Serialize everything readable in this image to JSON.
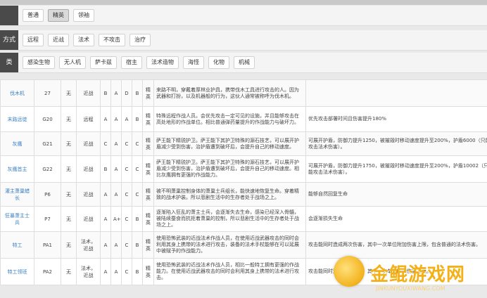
{
  "filters": [
    {
      "label": "",
      "chips": [
        "普通",
        "精英",
        "领袖"
      ],
      "active": 1
    },
    {
      "label": "方式",
      "chips": [
        "远程",
        "近战",
        "法术",
        "不攻击",
        "治疗"
      ],
      "active": -1
    },
    {
      "label": "类",
      "chips": [
        "感染生物",
        "无人机",
        "萨卡兹",
        "宿主",
        "法术造物",
        "海怪",
        "化物",
        "机械"
      ],
      "active": -1
    }
  ],
  "rows": [
    {
      "name": "伐木机",
      "code": "27",
      "def": "无",
      "atk": "近战",
      "s": [
        "B",
        "A",
        "D",
        "B"
      ],
      "lvl": "精英",
      "desc": "来路不明，穿戴着厚林业护具，携带伐木工具进行攻击的人。因为武器和打扮，以及机器般的行为，这伙人通常被称呼为伐木机。",
      "note": ""
    },
    {
      "name": "末路远徒",
      "code": "G20",
      "def": "无",
      "atk": "远程",
      "s": [
        "A",
        "A",
        "A",
        "B"
      ],
      "lvl": "精英",
      "desc": "特殊远程作战人员。会优先攻击一定可见的设施，并且能够攻击在高处地形的作战单位。相比普通弹药量提升的作战能力与破坏力。",
      "note": "优先攻击部署时间且伤害提升180%"
    },
    {
      "name": "灰鹰",
      "code": "G21",
      "def": "无",
      "atk": "近战",
      "s": [
        "C",
        "A",
        "C",
        "C"
      ],
      "lvl": "精英",
      "desc": "萨王能下精锐护卫。萨王能下其护卫特殊的源石技艺，可以展开护盾减少受到伤害，治护盾遭到破坏后，会提升自己的移动速度。",
      "note": "可展开护盾，防御力提升1250，被摧毁时移动速度提升至200%，护盾6000（只能攻击法术伤害）。"
    },
    {
      "name": "灰鹰首主",
      "code": "G22",
      "def": "无",
      "atk": "近战",
      "s": [
        "B",
        "A",
        "C",
        "C"
      ],
      "lvl": "精英",
      "desc": "萨王能下精锐护卫。萨王能下其护卫特殊的源石技艺，可以展开护盾减少受到伤害，治护盾遭到破坏后，会提升自己的移动速度。相比灰鹰拥有更强的作战能力。",
      "note": "可展开护盾，防御力提升1750，被摧毁时移动速度提升至200%，护盾10002（只能攻击法术伤害）。"
    },
    {
      "name": "灌主萧巢蜡长",
      "code": "P6",
      "def": "无",
      "atk": "近战",
      "s": [
        "A",
        "A",
        "C",
        "C"
      ],
      "lvl": "精英",
      "desc": "被不明萧巢控制身体的萧巢士兵组长，能快速地恢复生命。穿着精致的战术护装。所以悲剧生活中的生存者处于战场之上。",
      "note": "能够自然回复生命"
    },
    {
      "name": "狂暴萧主士兵",
      "code": "P7",
      "def": "无",
      "atk": "近战",
      "s": [
        "A",
        "A+",
        "C",
        "B"
      ],
      "lvl": "精英",
      "desc": "逐渐陷入狂乱的萧主士兵，会逐渐失去生命，感染已经深入骨髓，被陆续蚕食而抗拒着萧巢的控制，所以悲剧生活中的生存者处于战场之上。",
      "note": "会逐渐损失生命"
    },
    {
      "name": "特工",
      "code": "PA1",
      "def": "无",
      "atk": "法术，近战",
      "s": [
        "A",
        "A",
        "C",
        "B"
      ],
      "lvl": "精英",
      "desc": "使用恐怖武装的近战法术作战人员，在使用近战武器攻击的同时会利用其身上携带的法术进行攻击，装备的法术手杖能够在可以延展中被赋予的作战能力。",
      "note": "攻击能同时造成两次伤害，其中一次单位附加伤害上限，包含普通的法术伤害。"
    },
    {
      "name": "特工领班",
      "code": "PA2",
      "def": "无",
      "atk": "法术，近战",
      "s": [
        "A",
        "A",
        "C",
        "B"
      ],
      "lvl": "精英",
      "desc": "使用恐怖武装的近战法术作战人员，相比一般特工拥有更强的作战能力。在使用近战武器攻击的同时会利用其身上携带的法术进行攻击。",
      "note": "攻击能同时造成两次伤害，其中一次单位附加伤害上限。"
    }
  ],
  "watermark": {
    "text": "金鲲游戏网",
    "url": "JINKUNYOUXIWANG.COM"
  },
  "colors": {
    "name_link": "#3b7fc4",
    "filter_label_bg": "#4a4a4a",
    "watermark": "#f3b117"
  }
}
